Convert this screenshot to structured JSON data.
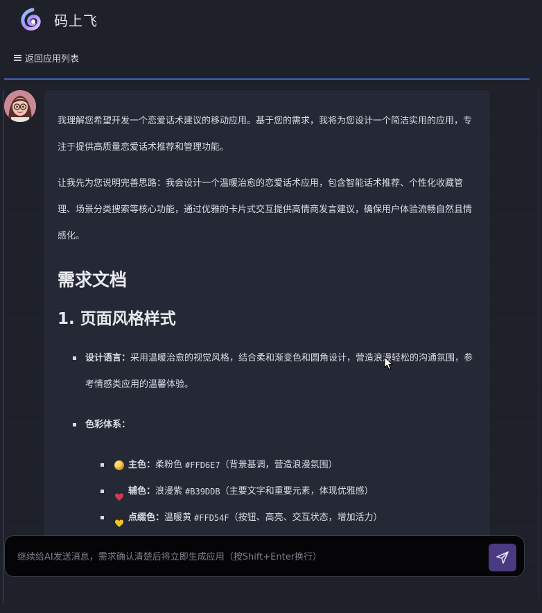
{
  "app": {
    "title": "码上飞",
    "logo_icon": "brand-logo",
    "accent": "#3f63b8"
  },
  "nav": {
    "back_label": "返回应用列表",
    "menu_icon": "menu-icon"
  },
  "message": {
    "avatar_icon": "assistant-avatar",
    "intro": "我理解您希望开发一个恋爱话术建议的移动应用。基于您的需求，我将为您设计一个简洁实用的应用，专注于提供高质量恋爱话术推荐和管理功能。",
    "plan": "让我先为您说明完善思路：我会设计一个温暖治愈的恋爱话术应用，包含智能话术推荐、个性化收藏管理、场景分类搜索等核心功能，通过优雅的卡片式交互提供高情商发言建议，确保用户体验流畅自然且情感化。",
    "doc_title": "需求文档",
    "section_title": "1. 页面风格样式",
    "items": [
      {
        "label": "设计语言：",
        "text": "采用温暖治愈的视觉风格，结合柔和渐变色和圆角设计，营造浪漫轻松的沟通氛围，参考情感类应用的温馨体验。"
      },
      {
        "label": "色彩体系：",
        "text": ""
      }
    ],
    "colors": [
      {
        "emoji": "palette-icon",
        "label": "主色：",
        "name": "柔粉色",
        "hex": "#FFD6E7",
        "note": "（背景基调，营造浪漫氛围）",
        "swatch": "#e8a93a"
      },
      {
        "emoji": "heart-icon",
        "label": "辅色：",
        "name": "浪漫紫",
        "hex": "#B39DDB",
        "note": "（主要文字和重要元素，体现优雅感）",
        "swatch": "#d23a4e"
      },
      {
        "emoji": "yellow-heart-icon",
        "label": "点缀色：",
        "name": "温暖黄",
        "hex": "#FFD54F",
        "note": "（按钮、高亮、交互状态，增加活力）",
        "swatch": "#f5c518"
      }
    ]
  },
  "composer": {
    "placeholder": "继续给AI发送消息，需求确认清楚后将立即生成应用（按Shift+Enter换行）",
    "send_icon": "send-icon",
    "send_color": "#4a3a82"
  }
}
